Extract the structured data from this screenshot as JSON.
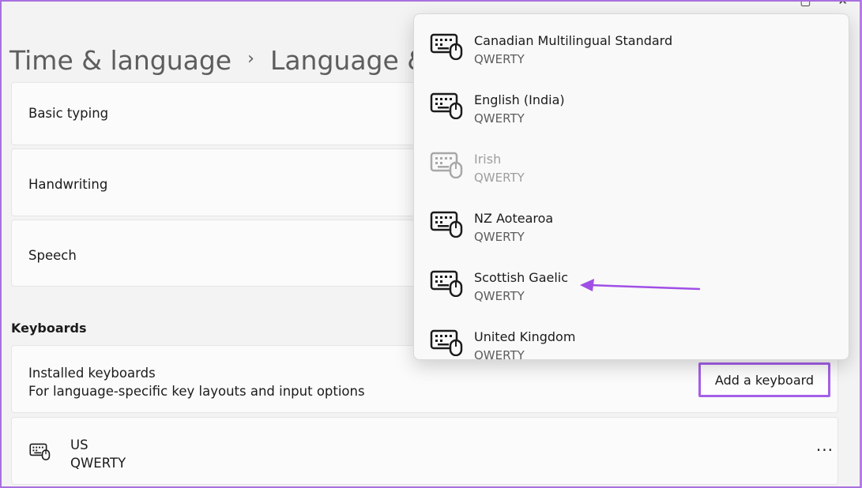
{
  "window": {
    "maximize_glyph": "▢",
    "close_glyph": "✕"
  },
  "breadcrumb": {
    "parent": "Time & language",
    "separator": "›",
    "current": "Language &"
  },
  "settings_cards": [
    {
      "label": "Basic typing"
    },
    {
      "label": "Handwriting"
    },
    {
      "label": "Speech"
    }
  ],
  "keyboards": {
    "section_title": "Keyboards",
    "installed_title": "Installed keyboards",
    "installed_subtitle": "For language-specific key layouts and input options",
    "add_button_label": "Add a keyboard",
    "installed": [
      {
        "name": "US",
        "layout": "QWERTY",
        "more_glyph": "···"
      }
    ]
  },
  "flyout": {
    "items": [
      {
        "name": "Canadian Multilingual Standard",
        "layout": "QWERTY",
        "disabled": false,
        "icon": "keyboard-icon"
      },
      {
        "name": "English (India)",
        "layout": "QWERTY",
        "disabled": false,
        "icon": "keyboard-icon"
      },
      {
        "name": "Irish",
        "layout": "QWERTY",
        "disabled": true,
        "icon": "keyboard-icon"
      },
      {
        "name": "NZ Aotearoa",
        "layout": "QWERTY",
        "disabled": false,
        "icon": "keyboard-icon"
      },
      {
        "name": "Scottish Gaelic",
        "layout": "QWERTY",
        "disabled": false,
        "icon": "keyboard-icon"
      },
      {
        "name": "United Kingdom",
        "layout": "QWERTY",
        "disabled": false,
        "icon": "keyboard-icon"
      }
    ]
  },
  "annotation": {
    "arrow_color": "#a04fe6"
  }
}
